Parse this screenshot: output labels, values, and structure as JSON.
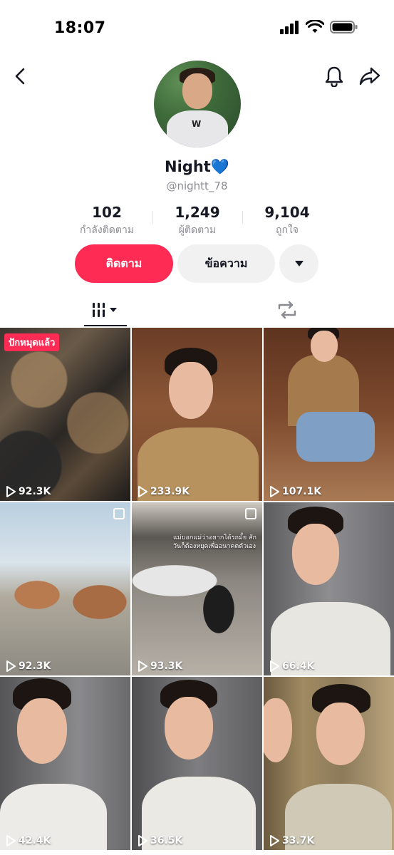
{
  "status_bar": {
    "time": "18:07"
  },
  "profile": {
    "display_name": "Night💙",
    "username": "@nightt_78",
    "avatar_shirt_text": "W"
  },
  "stats": [
    {
      "value": "102",
      "label": "กำลังติดตาม"
    },
    {
      "value": "1,249",
      "label": "ผู้ติดตาม"
    },
    {
      "value": "9,104",
      "label": "ถูกใจ"
    }
  ],
  "actions": {
    "follow_label": "ติดตาม",
    "message_label": "ข้อความ"
  },
  "colors": {
    "accent": "#fe2c55",
    "secondary_button": "#f1f1f2",
    "muted_text": "#8a8b91"
  },
  "tabs": [
    {
      "name": "videos",
      "icon": "grid-bars-icon",
      "active": true
    },
    {
      "name": "reposts",
      "icon": "repost-icon",
      "active": false
    }
  ],
  "videos": [
    {
      "views": "92.3K",
      "badge": "ปักหมุดแล้ว"
    },
    {
      "views": "233.9K"
    },
    {
      "views": "107.1K"
    },
    {
      "views": "92.3K",
      "multi": true
    },
    {
      "views": "93.3K",
      "multi": true,
      "caption": "แม่บอกแม่ว่าอยากได้รถมั้ย สักวันก็ต้องหยุดเพื่ออนาคตตัวเอง"
    },
    {
      "views": "66.4K"
    },
    {
      "views": "42.4K"
    },
    {
      "views": "36.5K"
    },
    {
      "views": "33.7K"
    }
  ]
}
